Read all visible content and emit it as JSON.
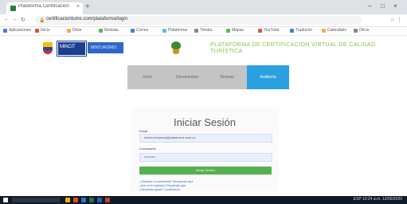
{
  "browser": {
    "tab_title": "Plataforma Certificación Virtual",
    "tab_close": "×",
    "new_tab": "+",
    "window_controls": [
      "–",
      "□",
      "×"
    ],
    "url": "certificaciontumx.com/plataforma/login",
    "bookmarks": [
      {
        "label": "Aplicaciones",
        "color": "#4a7ddb"
      },
      {
        "label": "Inicio",
        "color": "#d9534f"
      },
      {
        "label": "Drive",
        "color": "#f0ad4e"
      },
      {
        "label": "Noticias",
        "color": "#5cb85c"
      },
      {
        "label": "Correo",
        "color": "#4a7ddb"
      },
      {
        "label": "Plataforma",
        "color": "#5bc0de"
      },
      {
        "label": "Tienda",
        "color": "#888888"
      },
      {
        "label": "Mapas",
        "color": "#5cb85c"
      },
      {
        "label": "YouTube",
        "color": "#d9534f"
      },
      {
        "label": "Traductor",
        "color": "#4a7ddb"
      },
      {
        "label": "Calendario",
        "color": "#f0ad4e"
      },
      {
        "label": "Otros",
        "color": "#888888"
      }
    ]
  },
  "header": {
    "gov_logo_text": "MINCIT",
    "ministry_text": "MINTURISMO",
    "platform_title": "PLATAFORMA DE CERTIFICACIÓN VIRTUAL DE CALIDAD TURÍSTICA"
  },
  "nav": {
    "items": [
      {
        "label": "Inicio",
        "active": false
      },
      {
        "label": "Documentos",
        "active": false
      },
      {
        "label": "Normas",
        "active": false
      },
      {
        "label": "Auditoría",
        "active": true
      }
    ]
  },
  "login": {
    "title": "Iniciar Sesión",
    "email_label": "Email",
    "email_value": "admin.empresa@plataforma.com.co",
    "password_label": "Contraseña",
    "password_value": "••••••••••",
    "submit_label": "Iniciar Sesión",
    "links": [
      "¿Olvidaste tu contraseña? Recupérala aquí",
      "¿Aún no te registras? Regístrate aquí",
      "¿Necesitas ayuda? Contáctanos"
    ]
  },
  "taskbar": {
    "tray_text": "ESP  10:24 a.m.  12/05/2020"
  }
}
